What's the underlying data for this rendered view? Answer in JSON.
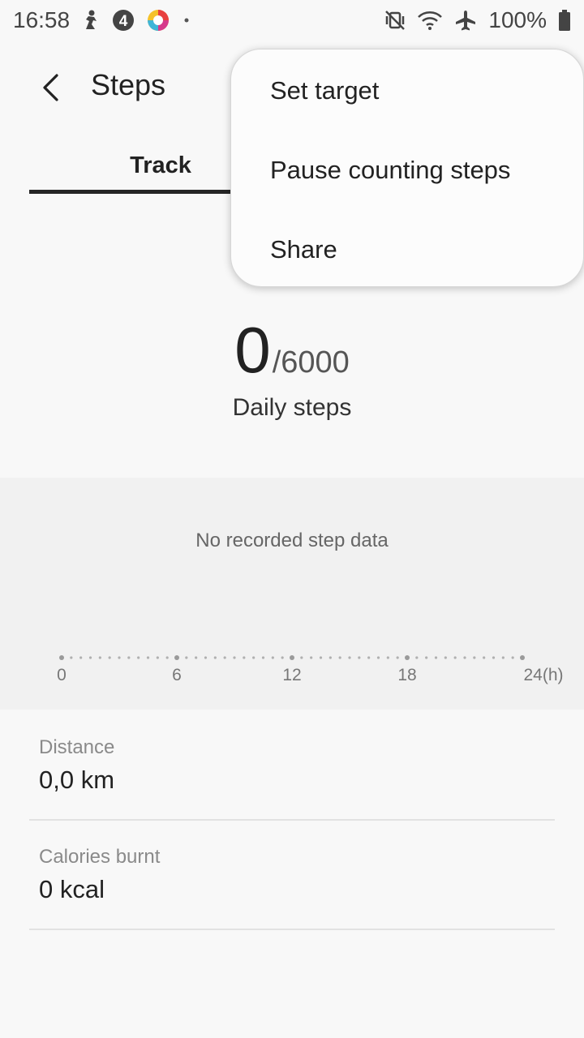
{
  "status_bar": {
    "time": "16:58",
    "battery": "100%",
    "notification_icons": [
      "fitness-figure-icon",
      "number-badge-icon",
      "colorful-app-icon",
      "dot-icon"
    ],
    "system_icons": [
      "mute-vibrate-icon",
      "wifi-icon",
      "airplane-icon",
      "battery-icon"
    ],
    "badge_number": "4"
  },
  "header": {
    "title": "Steps",
    "back_icon": "chevron-left-icon"
  },
  "tabs": [
    {
      "label": "Track",
      "selected": true
    }
  ],
  "summary": {
    "current": "0",
    "target": "/6000",
    "label": "Daily steps"
  },
  "chart_data": {
    "type": "bar",
    "empty_message": "No recorded step data",
    "x_ticks": [
      "0",
      "6",
      "12",
      "18",
      "24(h)"
    ],
    "xlim": [
      0,
      24
    ],
    "values": []
  },
  "stats": {
    "distance_label": "Distance",
    "distance_value": "0,0 km",
    "calories_label": "Calories burnt",
    "calories_value": "0 kcal"
  },
  "menu": {
    "items": [
      "Set target",
      "Pause counting steps",
      "Share"
    ]
  },
  "colors": {
    "background": "#f8f8f8",
    "chart_background": "#f1f1f1",
    "tab_indicator": "#252525",
    "menu_background": "#fcfcfc"
  }
}
